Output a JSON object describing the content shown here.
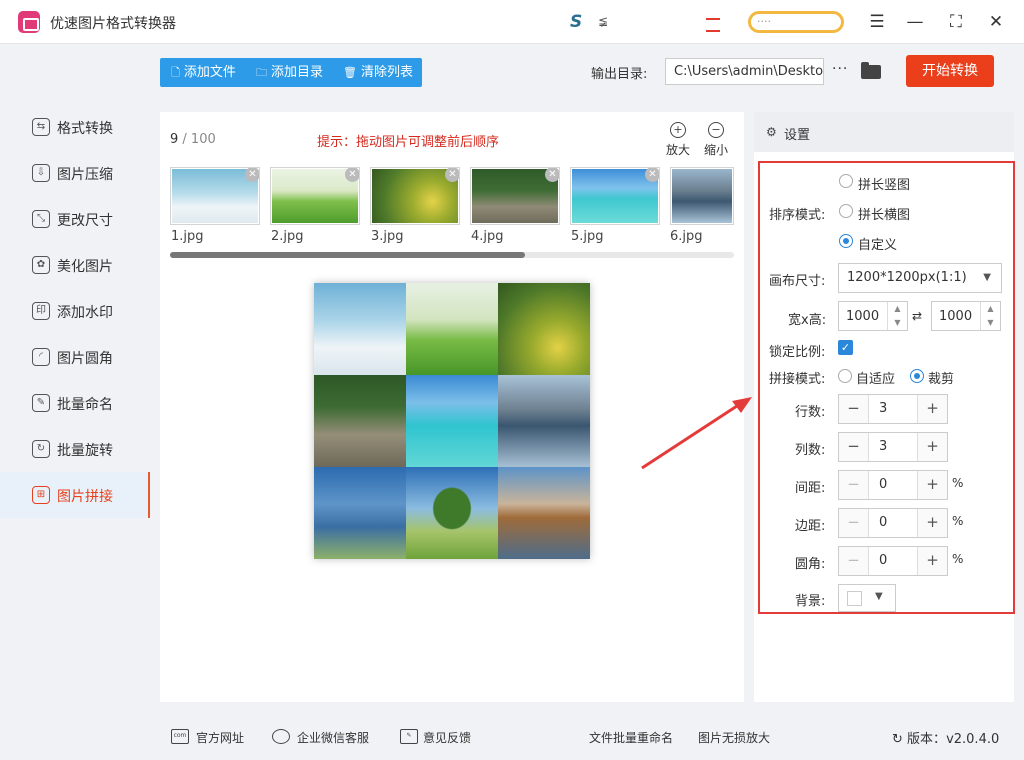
{
  "app": {
    "title": "优速图片格式转换器",
    "tb_s": "S",
    "tb_s2": "≨",
    "tb_pill": "····"
  },
  "window": {
    "menu": "☰",
    "minimize": "—",
    "maximize": "⛶",
    "close": "✕"
  },
  "sidebar": {
    "items": [
      {
        "label": "格式转换",
        "icon": "⇆"
      },
      {
        "label": "图片压缩",
        "icon": "⇩"
      },
      {
        "label": "更改尺寸",
        "icon": "⤡"
      },
      {
        "label": "美化图片",
        "icon": "✿"
      },
      {
        "label": "添加水印",
        "icon": "印"
      },
      {
        "label": "图片圆角",
        "icon": "◜"
      },
      {
        "label": "批量命名",
        "icon": "✎"
      },
      {
        "label": "批量旋转",
        "icon": "↻"
      },
      {
        "label": "图片拼接",
        "icon": "⊞"
      }
    ],
    "active_index": 8
  },
  "toolbar": {
    "add_file": "添加文件",
    "add_dir": "添加目录",
    "clear": "清除列表",
    "add_file_icon": "🗋",
    "add_dir_icon": "🗀",
    "clear_icon": "🗑"
  },
  "output": {
    "label": "输出目录:",
    "path": "C:\\Users\\admin\\Deskto",
    "more": "···"
  },
  "start_button": "开始转换",
  "list": {
    "count": "9",
    "total": "/ 100",
    "hint": "提示：拖动图片可调整前后顺序",
    "zoom_in": "放大",
    "zoom_out": "缩小",
    "zoom_in_icon": "+",
    "zoom_out_icon": "−"
  },
  "thumbs": [
    "1.jpg",
    "2.jpg",
    "3.jpg",
    "4.jpg",
    "5.jpg",
    "6.jpg"
  ],
  "settings": {
    "title": "设置",
    "sort_label": "排序模式:",
    "sort_options": [
      "拼长竖图",
      "拼长横图",
      "自定义"
    ],
    "sort_selected": "自定义",
    "canvas_label": "画布尺寸:",
    "canvas_value": "1200*1200px(1:1)",
    "wh_label": "宽x高:",
    "width": "1000",
    "height": "1000",
    "lock_label": "锁定比例:",
    "lock_checked": true,
    "join_label": "拼接模式:",
    "join_options": [
      "自适应",
      "裁剪"
    ],
    "join_selected": "裁剪",
    "rows_label": "行数:",
    "rows": "3",
    "cols_label": "列数:",
    "cols": "3",
    "spacing_label": "间距:",
    "spacing": "0",
    "margin_label": "边距:",
    "margin": "0",
    "radius_label": "圆角:",
    "radius": "0",
    "bg_label": "背景:",
    "percent": "%",
    "bg_color": "#ffffff"
  },
  "footer": {
    "site": "官方网址",
    "wechat": "企业微信客服",
    "feedback": "意见反馈",
    "batch_rename": "文件批量重命名",
    "upscale": "图片无损放大",
    "version_label": "版本：",
    "version": "v2.0.4.0"
  },
  "colors": {
    "accent": "#2d9be8",
    "start": "#ea3f1a",
    "hint": "#d42a1e",
    "highlight_box": "#e53a3a"
  }
}
